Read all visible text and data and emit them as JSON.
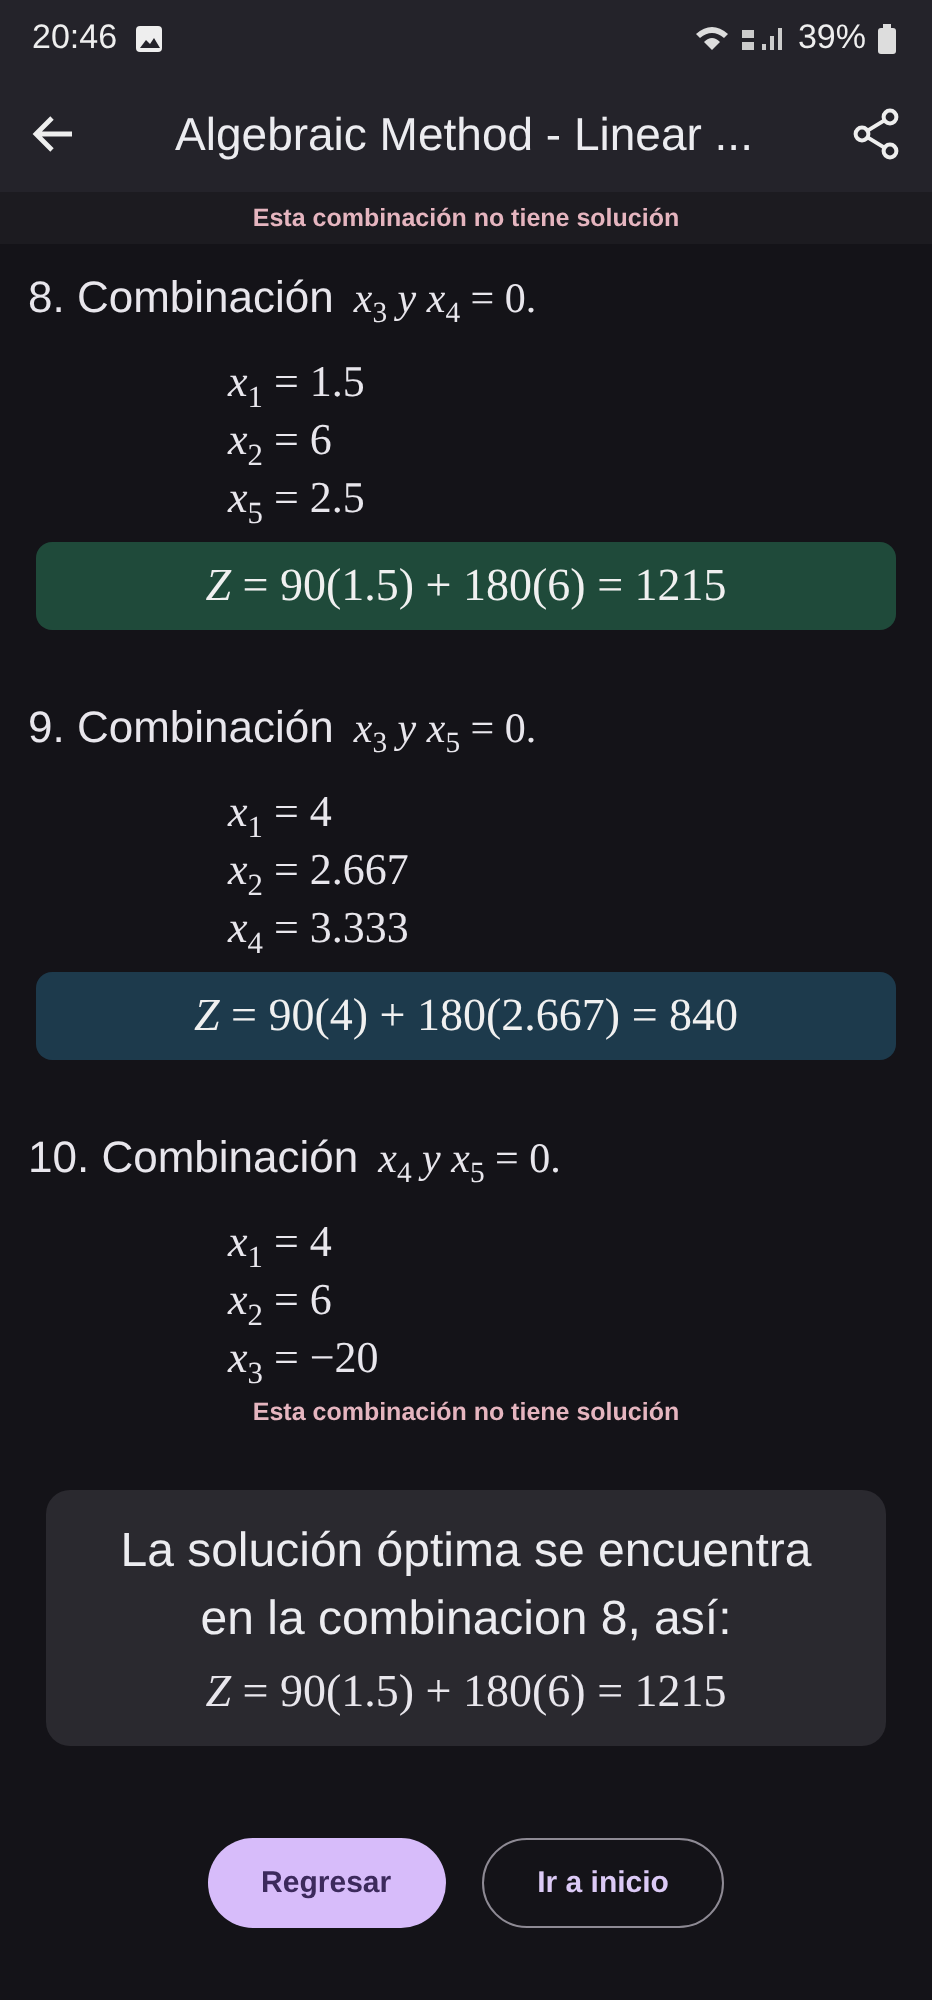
{
  "status_bar": {
    "time": "20:46",
    "battery": "39%"
  },
  "app_bar": {
    "title": "Algebraic Method - Linear ..."
  },
  "top_note": "Esta combinación no tiene solución",
  "combinations": [
    {
      "title": "8. Combinación",
      "condition": "*x*$_{3}$ *y* *x*$_{4}$ = 0.",
      "values": [
        "*x*$_{1}$ = 1.5",
        "*x*$_{2}$ = 6",
        "*x*$_{5}$ = 2.5"
      ],
      "kind": "result",
      "result": "*Z* = 90(1.5) + 180(6) = 1215",
      "color": "#1f4a3a"
    },
    {
      "title": "9. Combinación",
      "condition": "*x*$_{3}$ *y* *x*$_{5}$ = 0.",
      "values": [
        "*x*$_{1}$ = 4",
        "*x*$_{2}$ = 2.667",
        "*x*$_{4}$ = 3.333"
      ],
      "kind": "result",
      "result": "*Z* = 90(4) + 180(2.667) = 840",
      "color": "#1d3a4c"
    },
    {
      "title": "10. Combinación",
      "condition": "*x*$_{4}$ *y* *x*$_{5}$ = 0.",
      "values": [
        "*x*$_{1}$ = 4",
        "*x*$_{2}$ = 6",
        "*x*$_{3}$ = −20"
      ],
      "kind": "no_solution",
      "note": "Esta combinación no tiene solución"
    }
  ],
  "summary": {
    "text": "La solución óptima se encuentra en la combinacion 8, así:",
    "formula": "*Z* = 90(1.5) + 180(6) = 1215"
  },
  "buttons": [
    {
      "label": "Regresar",
      "kind": "filled"
    },
    {
      "label": "Ir a inicio",
      "kind": "outlined"
    }
  ]
}
